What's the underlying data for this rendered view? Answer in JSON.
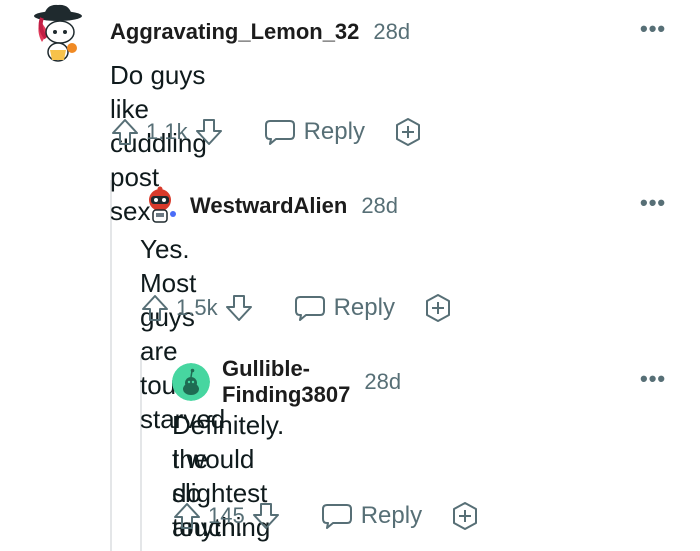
{
  "comments": [
    {
      "username": "Aggravating_Lemon_32",
      "age": "28d",
      "text": "Do guys like cuddling post sex?",
      "score": "1.1k",
      "reply_label": "Reply",
      "more_label": "•••",
      "avatar": "snoo-avatar-red-hair-hat"
    },
    {
      "username": "WestwardAlien",
      "age": "28d",
      "text": "Yes. Most guys are touch starved",
      "score": "1.5k",
      "reply_label": "Reply",
      "more_label": "•••",
      "avatar": "snoo-avatar-robot-helmet"
    },
    {
      "username": "Gullible-Finding3807",
      "age": "28d",
      "text_line1": "Definitely. I would do anything for even",
      "text_line2": "the slightest touch.",
      "score": "145",
      "reply_label": "Reply",
      "more_label": "•••",
      "avatar": "default-snoo-avatar-green"
    }
  ],
  "colors": {
    "meta": "#576f76",
    "thread_line": "#e4e6e8",
    "avatar_green": "#47d6a0"
  }
}
